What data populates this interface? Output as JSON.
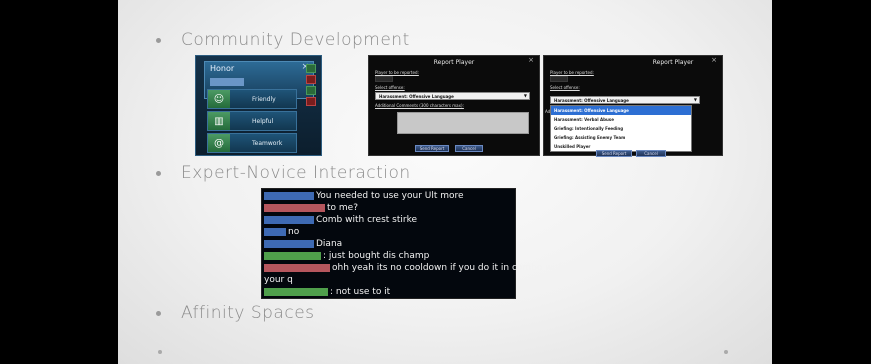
{
  "slide": {
    "bullets": [
      {
        "text": "Community Development"
      },
      {
        "text": "Expert-Novice Interaction"
      },
      {
        "text": "Affinity Spaces"
      }
    ]
  },
  "honor_panel": {
    "title": "Honor",
    "close": "×",
    "options": [
      {
        "label": "Friendly",
        "icon": "happy-face-icon"
      },
      {
        "label": "Helpful",
        "icon": "open-book-icon"
      },
      {
        "label": "Teamwork",
        "icon": "swirl-icon"
      }
    ]
  },
  "report_dialog_1": {
    "title": "Report Player",
    "close": "×",
    "player_label": "Player to be reported:",
    "offense_label": "Select offense:",
    "offense_selected": "Harassment: Offensive Language",
    "comments_label": "Additional Comments (300 characters max):",
    "send_label": "Send Report",
    "cancel_label": "Cancel"
  },
  "report_dialog_2": {
    "title": "Report Player",
    "close": "×",
    "player_label": "Player to be reported:",
    "offense_label": "Select offense:",
    "offense_selected": "Harassment: Offensive Language",
    "comments_prefix": "Add",
    "dropdown_options": [
      "Harassment: Offensive Language",
      "Harassment: Verbal Abuse",
      "Griefing: Intentionally Feeding",
      "Griefing: Assisting Enemy Team",
      "Unskilled Player"
    ],
    "send_label": "Send Report",
    "cancel_label": "Cancel"
  },
  "chat": {
    "lines": [
      {
        "name_color": "blue",
        "text": "You needed to use your Ult more"
      },
      {
        "name_color": "red",
        "text": "to me?"
      },
      {
        "name_color": "blue",
        "text": "Comb with crest stirke"
      },
      {
        "name_color": "blue",
        "text": "no"
      },
      {
        "name_color": "blue",
        "text": "Diana"
      },
      {
        "name_color": "green",
        "text": ": just bought dis champ"
      },
      {
        "name_color": "red",
        "text": "ohh yeah its no cooldown if you do it in combo with"
      },
      {
        "name_color": "none",
        "text": "your q"
      },
      {
        "name_color": "green",
        "text": ": not use to it"
      }
    ]
  }
}
